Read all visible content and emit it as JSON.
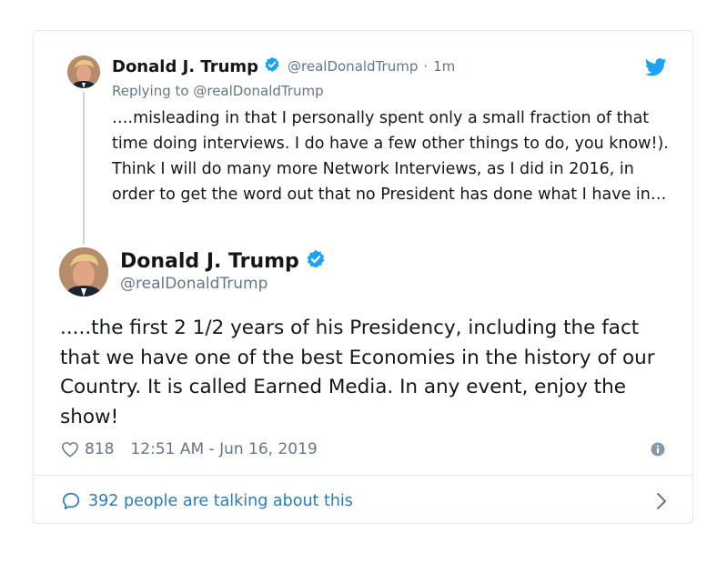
{
  "quoted_tweet": {
    "author_name": "Donald J. Trump",
    "handle": "@realDonaldTrump",
    "separator": "·",
    "time_ago": "1m",
    "replying_prefix": "Replying to",
    "replying_handle": "@realDonaldTrump",
    "text": "….misleading in that I personally spent only a small fraction of that time doing interviews. I do have a few other things to do, you know!). Think I will do many more Network Interviews, as I did in 2016, in order to get the word out that no President has done what I have in…"
  },
  "main_tweet": {
    "author_name": "Donald J. Trump",
    "handle": "@realDonaldTrump",
    "text": ".....the first 2 1/2 years of his Presidency, including the fact that we have one of the best Economies in the history of our Country. It is called Earned Media. In any event, enjoy the show!",
    "like_count": "818",
    "timestamp": "12:51 AM - Jun 16, 2019"
  },
  "footer": {
    "talking_text": "392 people are talking about this"
  },
  "colors": {
    "verified": "#1da1f2",
    "brand": "#1da1f2",
    "link": "#2b7bb9",
    "muted": "#657786",
    "text": "#14171a",
    "border": "#e1e8ed"
  }
}
